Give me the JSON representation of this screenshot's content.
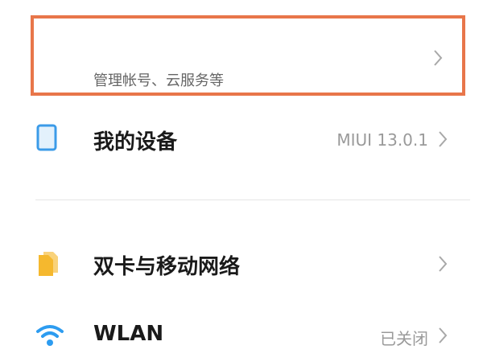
{
  "account": {
    "subtitle": "管理帐号、云服务等"
  },
  "settings": {
    "items": [
      {
        "label": "我的设备",
        "value": "MIUI 13.0.1",
        "icon": "device-icon"
      },
      {
        "label": "双卡与移动网络",
        "value": "",
        "icon": "sim-card-icon"
      },
      {
        "label": "WLAN",
        "value": "已关闭",
        "icon": "wifi-icon"
      }
    ]
  },
  "colors": {
    "highlight": "#E8764A",
    "device_icon": "#3B9BE8",
    "sim_icon": "#F5B82E",
    "wifi_icon": "#2D9CF0"
  }
}
